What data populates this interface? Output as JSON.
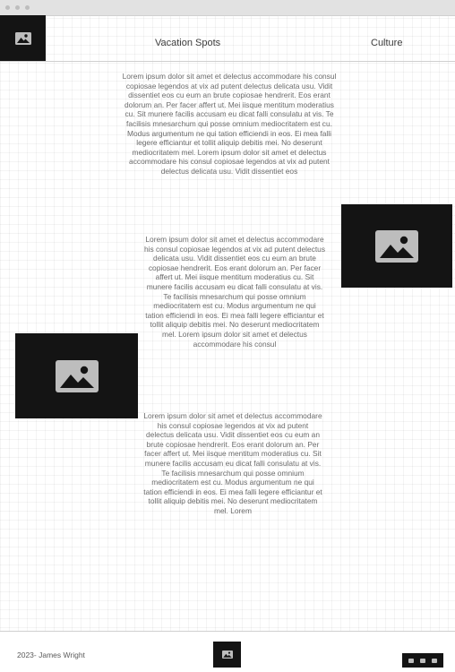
{
  "nav": {
    "items": [
      {
        "label": "Vacation Spots"
      },
      {
        "label": "Culture"
      }
    ]
  },
  "content": {
    "paragraphs": [
      "Lorem ipsum dolor sit amet et delectus accommodare his consul copiosae legendos at vix ad putent delectus delicata usu. Vidit dissentiet eos cu eum an brute copiosae hendrerit. Eos erant dolorum an. Per facer affert ut. Mei iisque mentitum moderatius cu. Sit munere facilis accusam eu dicat falli consulatu at vis. Te facilisis mnesarchum qui posse omnium mediocritatem est cu. Modus argumentum ne qui tation efficiendi in eos. Ei mea falli legere efficiantur et tollit aliquip debitis mei. No deserunt mediocritatem mel. Lorem ipsum dolor sit amet et delectus accommodare his consul copiosae legendos at vix ad putent delectus delicata usu. Vidit dissentiet eos",
      "Lorem ipsum dolor sit amet et delectus accommodare his consul copiosae legendos at vix ad putent delectus delicata usu. Vidit dissentiet eos cu eum an brute copiosae hendrerit. Eos erant dolorum an. Per facer affert ut. Mei iisque mentitum moderatius cu. Sit munere facilis accusam eu dicat falli consulatu at vis. Te facilisis mnesarchum qui posse omnium mediocritatem est cu. Modus argumentum ne qui tation efficiendi in eos. Ei mea falli legere efficiantur et tollit aliquip debitis mei. No deserunt mediocritatem mel. Lorem ipsum dolor sit amet et delectus accommodare his consul",
      "Lorem ipsum dolor sit amet et delectus accommodare his consul copiosae legendos at vix ad putent delectus delicata usu. Vidit dissentiet eos cu eum an brute copiosae hendrerit. Eos erant dolorum an. Per facer affert ut. Mei iisque mentitum moderatius cu. Sit munere facilis accusam eu dicat falli consulatu at vis. Te facilisis mnesarchum qui posse omnium mediocritatem est cu. Modus argumentum ne qui tation efficiendi in eos. Ei mea falli legere efficiantur et tollit aliquip debitis mei. No deserunt mediocritatem mel. Lorem"
    ]
  },
  "footer": {
    "copyright": "2023- James Wright"
  },
  "icons": {
    "logo": "image-placeholder-icon",
    "content_images": "image-placeholder-icon",
    "social": [
      "social-icon",
      "social-icon",
      "social-icon"
    ]
  },
  "colors": {
    "dark_block": "#141414",
    "icon_fill": "#bdbdbd",
    "text": "#6b6b6b",
    "nav_text": "#3c3c3c"
  }
}
